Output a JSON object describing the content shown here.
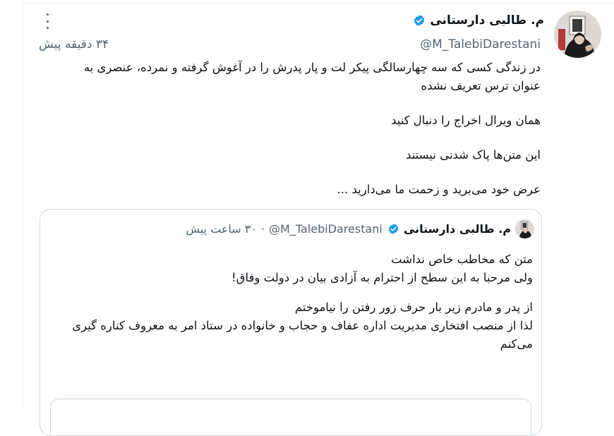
{
  "tweet": {
    "author_name": "م. طالبی دارستانی",
    "handle": "@M_TalebiDarestani",
    "time": "۳۴ دقیقه پیش",
    "paragraphs": [
      "در زندگی کسی که سه چهارسالگی پیکر لت و پار پدرش را در آغوش گرفته و نمرده، عنصری به عنوان ترس تعریف نشده",
      "همان ویرال اخراج را دنبال کنید",
      "این متن‌ها پاک شدنی نیستند",
      "عرض خود می‌برید و زحمت ما می‌دارید ..."
    ]
  },
  "quoted": {
    "author_name": "م. طالبی دارستانی",
    "handle": "@M_TalebiDarestani",
    "separator": "·",
    "time": "۳۰ ساعت پیش",
    "paragraphs": [
      [
        "متن که مخاطب خاص نداشت",
        "ولی مرحبا به این سطح از احترام به آزادی بیان در دولت وفاق!"
      ],
      [
        "از پدر و مادرم زیر بار حرف زور رفتن را نیاموختم",
        "لذا از منصب افتخاری مدیریت اداره عفاف و حجاب و خانواده در ستاد امر به معروف کناره گیری می‌کنم"
      ]
    ]
  },
  "icons": {
    "verified": "verified-badge-icon",
    "more": "more-options-icon"
  },
  "colors": {
    "verified": "#1d9bf0",
    "secondary_text": "#536471",
    "border": "#cfd9de"
  }
}
